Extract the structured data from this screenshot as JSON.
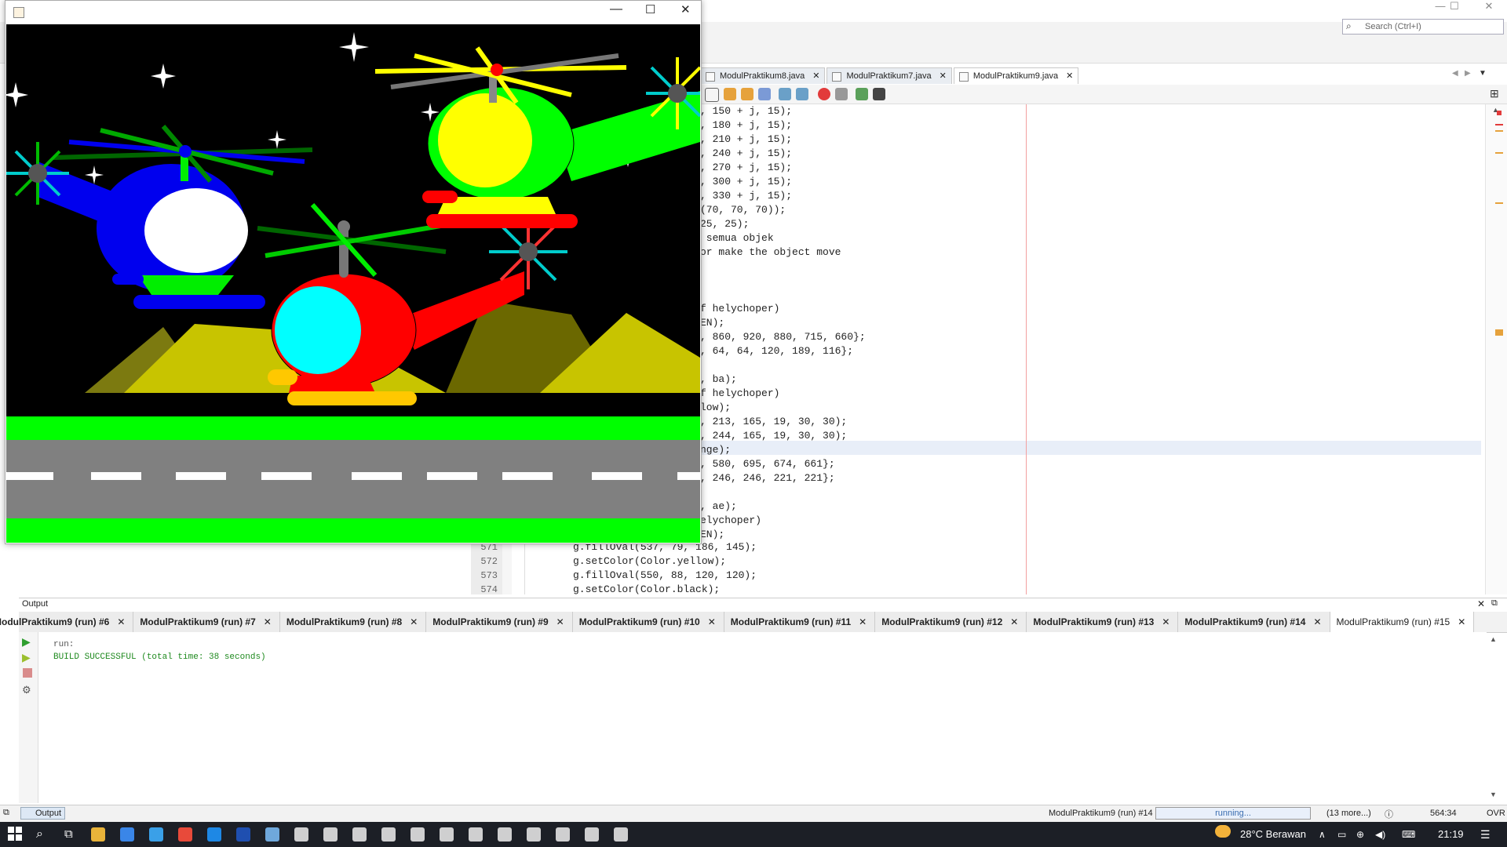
{
  "ide": {
    "search_placeholder": "Search (Ctrl+I)",
    "window_controls": [
      "—",
      "☐",
      "✕"
    ],
    "editor_tabs": [
      {
        "label": "ModulPraktikum8.java",
        "active": false
      },
      {
        "label": "ModulPraktikum7.java",
        "active": false
      },
      {
        "label": "ModulPraktikum9.java",
        "active": true
      }
    ],
    "visible_code_fragments": [
      ", 150 + j, 15);",
      ", 180 + j, 15);",
      ", 210 + j, 15);",
      ", 240 + j, 15);",
      ", 270 + j, 15);",
      ", 300 + j, 15);",
      ", 330 + j, 15);",
      "(70, 70, 70));",
      "25, 25);",
      " semua objek",
      "or make the object move",
      "",
      "",
      "",
      "f helychoper)",
      "EN);",
      ", 860, 920, 880, 715, 660};",
      ", 64, 64, 120, 189, 116};",
      "",
      ", ba);",
      "f helychoper)",
      "low);",
      ", 213, 165, 19, 30, 30);",
      ", 244, 165, 19, 30, 30);",
      "nge);",
      ", 580, 695, 674, 661};",
      ", 246, 246, 221, 221};",
      "",
      ", ae);",
      "elychoper)",
      "EN);"
    ],
    "code_lines": [
      {
        "num": "571",
        "text": "g.fillOval(537, 79, 186, 145);"
      },
      {
        "num": "572",
        "text": "g.setColor(Color.yellow);"
      },
      {
        "num": "573",
        "text": "g.fillOval(550, 88, 120, 120);"
      },
      {
        "num": "574",
        "text": "g.setColor(Color.black);"
      }
    ],
    "output": {
      "header": "Output",
      "tabs": [
        {
          "label": "ModulPraktikum9 (run) #6",
          "active": false
        },
        {
          "label": "ModulPraktikum9 (run) #7",
          "active": false
        },
        {
          "label": "ModulPraktikum9 (run) #8",
          "active": false
        },
        {
          "label": "ModulPraktikum9 (run) #9",
          "active": false
        },
        {
          "label": "ModulPraktikum9 (run) #10",
          "active": false
        },
        {
          "label": "ModulPraktikum9 (run) #11",
          "active": false
        },
        {
          "label": "ModulPraktikum9 (run) #12",
          "active": false
        },
        {
          "label": "ModulPraktikum9 (run) #13",
          "active": false
        },
        {
          "label": "ModulPraktikum9 (run) #14",
          "active": false
        },
        {
          "label": "ModulPraktikum9 (run) #15",
          "active": true
        }
      ],
      "lines": [
        "run:",
        "BUILD SUCCESSFUL (total time: 38 seconds)"
      ]
    },
    "status": {
      "output_button": "Output",
      "task": "ModulPraktikum9 (run) #14",
      "progress_text": "running...",
      "more": "(13 more...)",
      "position": "564:34",
      "mode": "OVR"
    }
  },
  "taskbar": {
    "weather": "28°C  Berawan",
    "time": "21:19"
  }
}
